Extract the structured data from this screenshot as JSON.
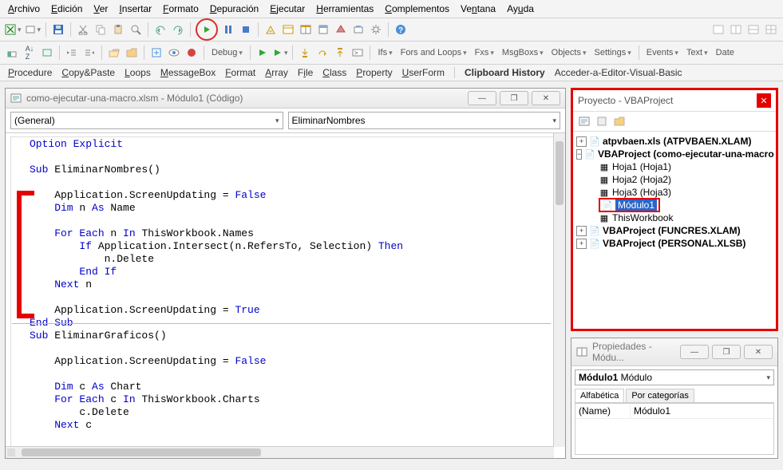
{
  "menu": [
    "Archivo",
    "Edición",
    "Ver",
    "Insertar",
    "Formato",
    "Depuración",
    "Ejecutar",
    "Herramientas",
    "Complementos",
    "Ventana",
    "Ayuda"
  ],
  "toolbar2": {
    "debug": "Debug",
    "ifs": "Ifs",
    "fors": "Fors and Loops",
    "fxs": "Fxs",
    "msgbox": "MsgBoxs",
    "objects": "Objects",
    "settings": "Settings",
    "events": "Events",
    "text": "Text",
    "date": "Date"
  },
  "linkrow": [
    "Procedure",
    "Copy&Paste",
    "Loops",
    "MessageBox",
    "Format",
    "Array",
    "File",
    "Class",
    "Property",
    "UserForm"
  ],
  "clipboard_title": "Clipboard History",
  "clipboard_item": "Acceder-a-Editor-Visual-Basic",
  "codewin": {
    "title": "como-ejecutar-una-macro.xlsm - Módulo1 (Código)",
    "combo_left": "(General)",
    "combo_right": "EliminarNombres"
  },
  "code": {
    "opt": "Option Explicit",
    "sub1": "Sub",
    "sub1n": " EliminarNombres()",
    "l1a": "    Application.ScreenUpdating = ",
    "l1b": "False",
    "dim1": "    Dim",
    "dim1b": " n ",
    "as1": "As",
    "dim1c": " Name",
    "for1": "    For Each",
    "for1b": " n ",
    "in1": "In",
    "for1c": " ThisWorkbook.Names",
    "if1": "        If",
    "if1b": " Application.Intersect(n.RefersTo, Selection) ",
    "then1": "Then",
    "del1": "            n.Delete",
    "endif1": "        End If",
    "next1": "    Next",
    "next1b": " n",
    "l2a": "    Application.ScreenUpdating = ",
    "l2b": "True",
    "endsub1": "End Sub",
    "sub2": "Sub",
    "sub2n": " EliminarGraficos()",
    "l3a": "    Application.ScreenUpdating = ",
    "l3b": "False",
    "dim2": "    Dim",
    "dim2b": " c ",
    "as2": "As",
    "dim2c": " Chart",
    "for2": "    For Each",
    "for2b": " c ",
    "in2": "In",
    "for2c": " ThisWorkbook.Charts",
    "del2": "        c.Delete",
    "next2": "    Next",
    "next2b": " c"
  },
  "project": {
    "title": "Proyecto - VBAProject",
    "items": {
      "p0": "atpvbaen.xls (ATPVBAEN.XLAM)",
      "p1": "VBAProject (como-ejecutar-una-macro",
      "h1": "Hoja1 (Hoja1)",
      "h2": "Hoja2 (Hoja2)",
      "h3": "Hoja3 (Hoja3)",
      "mod": "Módulo1",
      "twb": "ThisWorkbook",
      "p2": "VBAProject (FUNCRES.XLAM)",
      "p3": "VBAProject (PERSONAL.XLSB)"
    }
  },
  "props": {
    "title": "Propiedades - Módu...",
    "obj_bold": "Módulo1",
    "obj_rest": " Módulo",
    "tab1": "Alfabética",
    "tab2": "Por categorías",
    "row_name": "(Name)",
    "row_val": "Módulo1"
  }
}
